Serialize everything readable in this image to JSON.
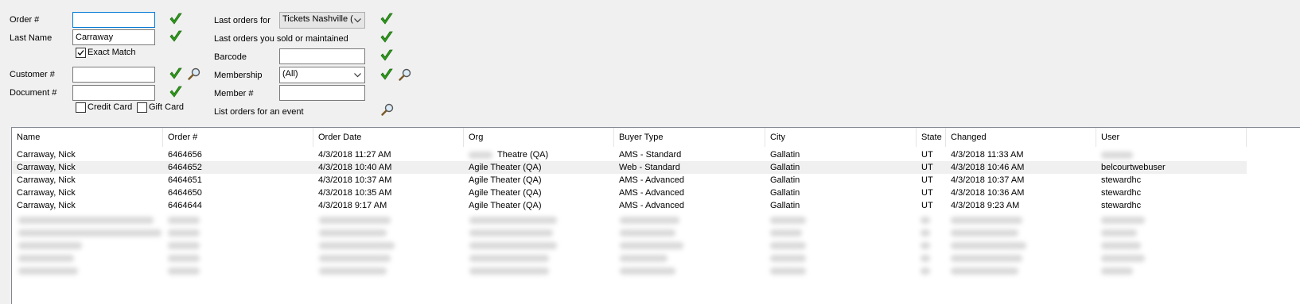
{
  "search": {
    "order_label": "Order #",
    "order_value": "",
    "lastname_label": "Last Name",
    "lastname_value": "Carraway",
    "exact_match_label": "Exact Match",
    "exact_match_checked": true,
    "customer_label": "Customer #",
    "customer_value": "",
    "document_label": "Document #",
    "document_value": "",
    "credit_card_label": "Credit Card",
    "gift_card_label": "Gift Card",
    "last_orders_for_label": "Last orders for",
    "last_orders_for_value": "Tickets Nashville (",
    "last_orders_sold_label": "Last orders you sold or maintained",
    "barcode_label": "Barcode",
    "barcode_value": "",
    "membership_label": "Membership",
    "membership_value": "(All)",
    "member_label": "Member #",
    "member_value": "",
    "list_event_label": "List orders for an event"
  },
  "icons": {
    "check": "checkmark-icon",
    "search": "magnifier-icon",
    "dropdown": "chevron-down-icon",
    "check_color": "#2e9e1a"
  },
  "grid": {
    "columns": [
      "Name",
      "Order #",
      "Order Date",
      "Org",
      "Buyer Type",
      "City",
      "State",
      "Changed",
      "User"
    ],
    "rows": [
      [
        "Carraway, Nick",
        "6464656",
        "4/3/2018 11:27 AM",
        "Theatre (QA)",
        "AMS - Standard",
        "Gallatin",
        "UT",
        "4/3/2018 11:33 AM",
        ""
      ],
      [
        "Carraway, Nick",
        "6464652",
        "4/3/2018 10:40 AM",
        "Agile Theater (QA)",
        "Web - Standard",
        "Gallatin",
        "UT",
        "4/3/2018 10:46 AM",
        "belcourtwebuser"
      ],
      [
        "Carraway, Nick",
        "6464651",
        "4/3/2018 10:37 AM",
        "Agile Theater (QA)",
        "AMS - Advanced",
        "Gallatin",
        "UT",
        "4/3/2018 10:37 AM",
        "stewardhc"
      ],
      [
        "Carraway, Nick",
        "6464650",
        "4/3/2018 10:35 AM",
        "Agile Theater (QA)",
        "AMS - Advanced",
        "Gallatin",
        "UT",
        "4/3/2018 10:36 AM",
        "stewardhc"
      ],
      [
        "Carraway, Nick",
        "6464644",
        "4/3/2018 9:17 AM",
        "Agile Theater (QA)",
        "AMS - Advanced",
        "Gallatin",
        "UT",
        "4/3/2018 9:23 AM",
        "stewardhc"
      ]
    ],
    "selected_row": 1
  }
}
